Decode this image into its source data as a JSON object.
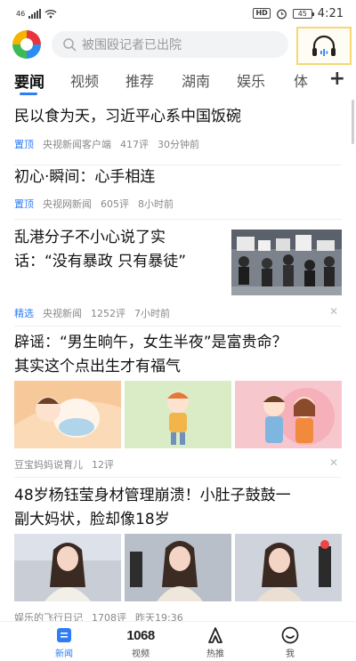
{
  "status": {
    "network": "46",
    "hd": "HD",
    "battery": "45",
    "time": "4:21"
  },
  "search": {
    "placeholder": "被围殴记者已出院"
  },
  "tabs": [
    "要闻",
    "视频",
    "推荐",
    "湖南",
    "娱乐",
    "体"
  ],
  "feed": [
    {
      "title": "民以食为天，习近平心系中国饭碗",
      "tag": "置顶",
      "source": "央视新闻客户端",
      "comments": "417评",
      "time": "30分钟前"
    },
    {
      "title": "初心·瞬间：心手相连",
      "tag": "置顶",
      "source": "央视网新闻",
      "comments": "605评",
      "time": "8小时前"
    },
    {
      "title_line1": "乱港分子不小心说了实",
      "title_line2": "话：“没有暴政 只有暴徒”",
      "tag": "精选",
      "source": "央视新闻",
      "comments": "1252评",
      "time": "7小时前"
    },
    {
      "title_line1": "辟谣：“男生晌午，女生半夜”是富贵命？",
      "title_line2": "其实这个点出生才有福气",
      "source": "豆宝妈妈说育儿",
      "comments": "12评"
    },
    {
      "title_line1": "48岁杨钰莹身材管理崩溃！小肚子鼓鼓一",
      "title_line2": "副大妈状，脸却像18岁",
      "source": "娱乐的飞行日记",
      "comments": "1708评",
      "time": "昨天19:36"
    }
  ],
  "bottom_nav": [
    {
      "label": "新闻",
      "icon": "news-icon"
    },
    {
      "label": "视频",
      "icon": "video-1068-icon",
      "icon_text": "1068"
    },
    {
      "label": "热推",
      "icon": "hot-recommend-icon"
    },
    {
      "label": "我",
      "icon": "me-face-icon"
    }
  ],
  "colors": {
    "accent": "#2f7df6",
    "highlight": "#f6d774"
  }
}
